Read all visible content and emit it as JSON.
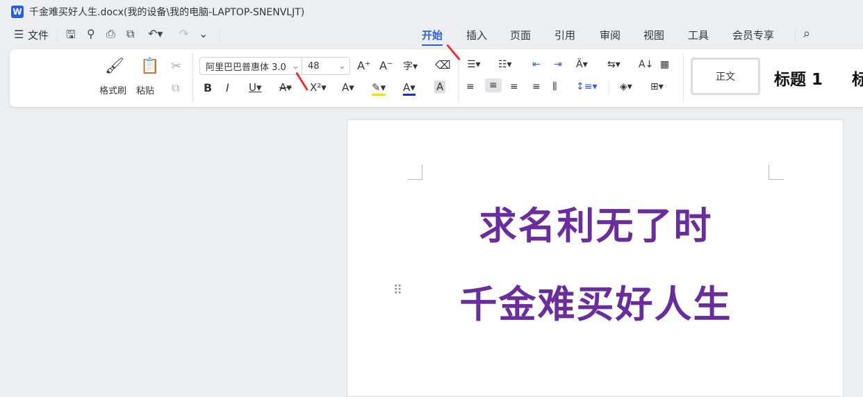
{
  "window": {
    "title": "千金难买好人生.docx(我的设备\\我的电脑-LAPTOP-SNENVLJT)",
    "logo": "W"
  },
  "menu": {
    "file": "文件",
    "tabs": [
      "开始",
      "插入",
      "页面",
      "引用",
      "审阅",
      "视图",
      "工具",
      "会员专享"
    ],
    "active_tab": "开始"
  },
  "ribbon": {
    "format_painter": "格式刷",
    "paste": "粘贴",
    "font_name": "阿里巴巴普惠体 3.0",
    "font_size": "48",
    "styles": [
      "正文",
      "标题 1",
      "标"
    ]
  },
  "colors": {
    "accent": "#2b5fd9",
    "text_purple": "#6a2d9c",
    "highlight": "#f5e400",
    "font_color": "#1a2fc7",
    "annotation_arrow": "#e8332b"
  },
  "document": {
    "lines": [
      "求名利无了时",
      "千金难买好人生"
    ]
  }
}
